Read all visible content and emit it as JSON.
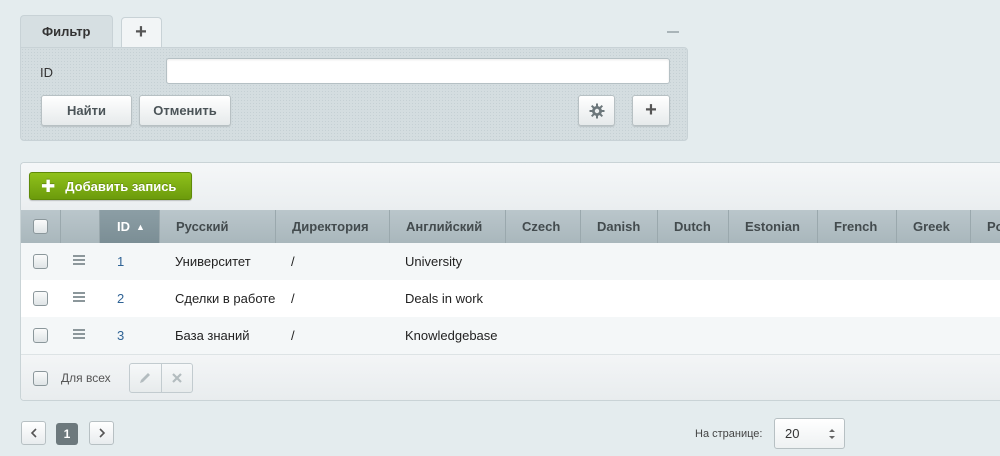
{
  "filter": {
    "tab_label": "Фильтр",
    "add_tab_label": "+",
    "field_label": "ID",
    "id_value": "",
    "find_label": "Найти",
    "cancel_label": "Отменить",
    "add_field_label": "+"
  },
  "grid": {
    "add_record_label": "Добавить запись",
    "columns": [
      "ID",
      "Русский",
      "Директория",
      "Английский",
      "Czech",
      "Danish",
      "Dutch",
      "Estonian",
      "French",
      "Greek",
      "Po"
    ],
    "sorted_column": "ID",
    "rows": [
      {
        "id": "1",
        "russian": "Университет",
        "directory": "/",
        "english": "University"
      },
      {
        "id": "2",
        "russian": "Сделки в работе",
        "directory": "/",
        "english": "Deals in work"
      },
      {
        "id": "3",
        "russian": "База знаний",
        "directory": "/",
        "english": "Knowledgebase"
      }
    ],
    "for_all_label": "Для всех"
  },
  "pagination": {
    "current_page": "1",
    "per_page_label": "На странице:",
    "per_page_value": "20"
  },
  "colors": {
    "accent_green": "#7fb014",
    "link_blue": "#2f6395",
    "header_gray": "#b1bec3"
  }
}
